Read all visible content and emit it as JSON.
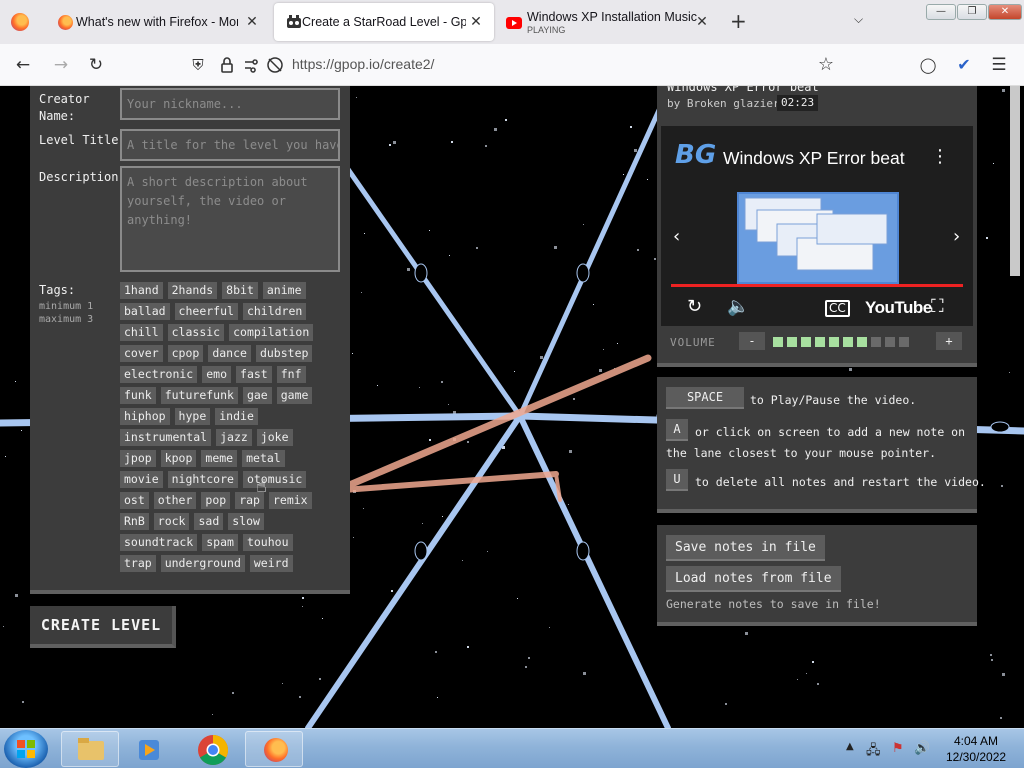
{
  "browser": {
    "tabs": [
      {
        "title": "What's new with Firefox - More",
        "close": "✕"
      },
      {
        "title": "Create a StarRoad Level - Gpop",
        "close": "✕"
      },
      {
        "title": "Windows XP Installation Music",
        "subtitle": "PLAYING",
        "close": "✕"
      }
    ],
    "new_tab": "+",
    "url": "https://gpop.io/create2/"
  },
  "form": {
    "creator_label": "Creator Name:",
    "creator_placeholder": "Your nickname...",
    "title_label": "Level Title:",
    "title_placeholder": "A title for the level you have cr",
    "description_label": "Description:",
    "description_placeholder": "A short description about yourself, the video or anything!",
    "tags_label": "Tags:",
    "tags_min": "minimum 1",
    "tags_max": "maximum 3",
    "tag_rows": [
      [
        "1hand",
        "2hands",
        "8bit",
        "anime"
      ],
      [
        "ballad",
        "cheerful",
        "children"
      ],
      [
        "chill",
        "classic",
        "compilation"
      ],
      [
        "cover",
        "cpop",
        "dance",
        "dubstep"
      ],
      [
        "electronic",
        "emo",
        "fast",
        "fnf"
      ],
      [
        "funk",
        "futurefunk",
        "gae",
        "game"
      ],
      [
        "hiphop",
        "hype",
        "indie"
      ],
      [
        "instrumental",
        "jazz",
        "joke"
      ],
      [
        "jpop",
        "kpop",
        "meme",
        "metal"
      ],
      [
        "movie",
        "nightcore",
        "otomusic"
      ],
      [
        "ost",
        "other",
        "pop",
        "rap",
        "remix"
      ],
      [
        "RnB",
        "rock",
        "sad",
        "slow"
      ],
      [
        "soundtrack",
        "spam",
        "touhou"
      ],
      [
        "trap",
        "underground",
        "weird"
      ]
    ],
    "create_button": "CREATE LEVEL"
  },
  "video": {
    "title": "Windows XP Error beat",
    "by": "by Broken glazier",
    "duration": "02:23",
    "yt_title": "Windows XP Error beat",
    "yt_channel_logo": "BG",
    "yt_brand": "YouTube",
    "volume_label": "VOLUME",
    "volume_minus": "-",
    "volume_plus": "+",
    "volume_level": 0.7,
    "volume_segments": 10
  },
  "help": {
    "space_key": "SPACE",
    "space_text": "to Play/Pause the video.",
    "a_key": "A",
    "a_text1": "or click on screen to add a new note on",
    "a_text2": "the lane closest to your mouse pointer.",
    "u_key": "U",
    "u_text": "to delete all notes and restart the video."
  },
  "file": {
    "save_button": "Save notes in file",
    "load_button": "Load notes from file",
    "hint": "Generate notes to save in file!"
  },
  "taskbar": {
    "time": "4:04 AM",
    "date": "12/30/2022"
  },
  "colors": {
    "panel": "#3c3c3c",
    "lane": "#a8c6f0",
    "note_line": "#f0a890",
    "volume_on": "#a8e0a0",
    "volume_off": "#6a6a6a"
  }
}
